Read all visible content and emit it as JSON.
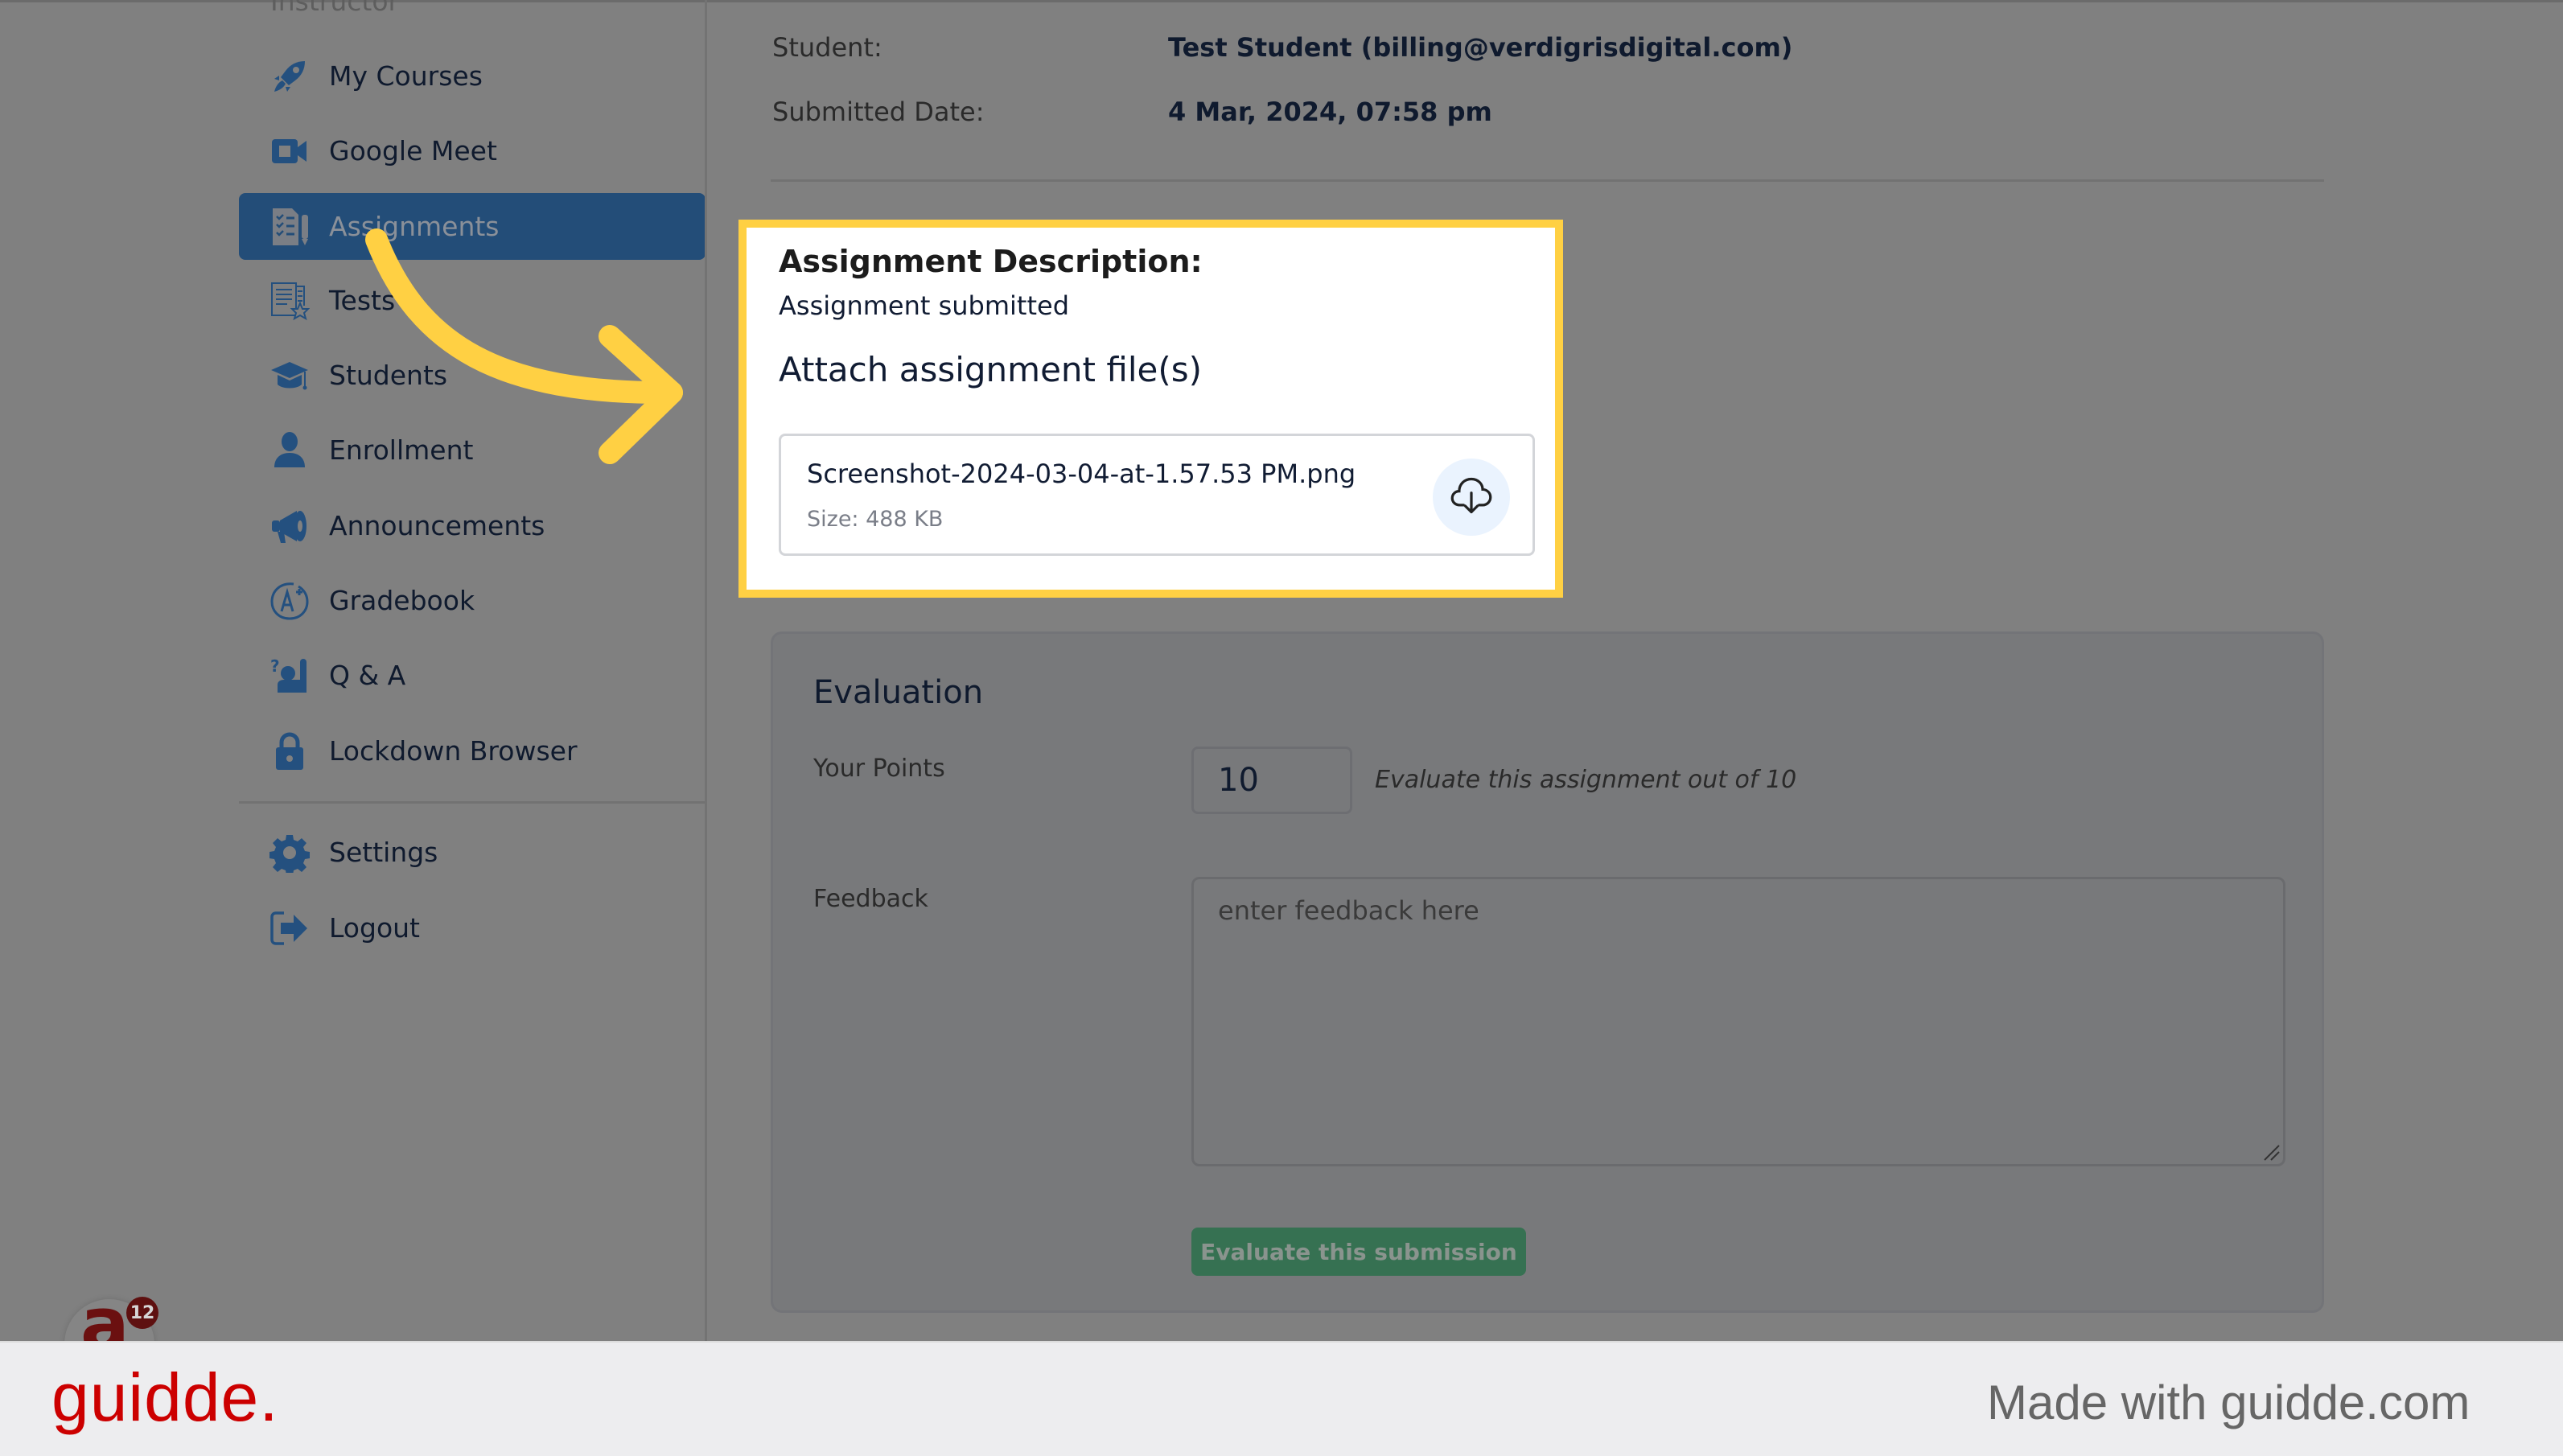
{
  "sidebar": {
    "section_label": "Instructor",
    "items": [
      {
        "label": "My Courses",
        "icon": "rocket-icon",
        "active": false
      },
      {
        "label": "Google Meet",
        "icon": "video-camera-icon",
        "active": false
      },
      {
        "label": "Assignments",
        "icon": "assignment-checklist-icon",
        "active": true
      },
      {
        "label": "Tests",
        "icon": "test-document-star-icon",
        "active": false
      },
      {
        "label": "Students",
        "icon": "graduation-cap-icon",
        "active": false
      },
      {
        "label": "Enrollment",
        "icon": "user-icon",
        "active": false
      },
      {
        "label": "Announcements",
        "icon": "megaphone-icon",
        "active": false
      },
      {
        "label": "Gradebook",
        "icon": "grade-a-plus-icon",
        "active": false
      },
      {
        "label": "Q & A",
        "icon": "question-raise-hand-icon",
        "active": false
      },
      {
        "label": "Lockdown Browser",
        "icon": "lock-icon",
        "active": false
      }
    ],
    "bottom_items": [
      {
        "label": "Settings",
        "icon": "gear-icon"
      },
      {
        "label": "Logout",
        "icon": "logout-icon"
      }
    ]
  },
  "submission": {
    "student_label": "Student:",
    "student_value": "Test Student (billing@verdigrisdigital.com)",
    "date_label": "Submitted Date:",
    "date_value": "4 Mar, 2024, 07:58 pm"
  },
  "assignment": {
    "description_title": "Assignment Description:",
    "description_text": "Assignment submitted",
    "attach_title": "Attach assignment file(s)",
    "file": {
      "name": "Screenshot-2024-03-04-at-1.57.53 PM.png",
      "size": "Size: 488 KB",
      "action_icon": "cloud-download-icon"
    }
  },
  "evaluation": {
    "title": "Evaluation",
    "points_label": "Your Points",
    "points_value": "10",
    "points_hint": "Evaluate this assignment out of 10",
    "feedback_label": "Feedback",
    "feedback_placeholder": "enter feedback here",
    "feedback_value": "",
    "submit_label": "Evaluate this submission"
  },
  "notification": {
    "avatar_glyph": "a",
    "badge_count": "12"
  },
  "footer": {
    "logo": "guidde.",
    "tagline": "Made with guidde.com"
  },
  "colors": {
    "overlay": "#808080",
    "active_nav": "#234d78",
    "icon_blue": "#24507f",
    "highlight_border": "#ffd043",
    "arrow": "#ffd043",
    "submit_button": "#367152",
    "brand_red": "#cc0000"
  }
}
